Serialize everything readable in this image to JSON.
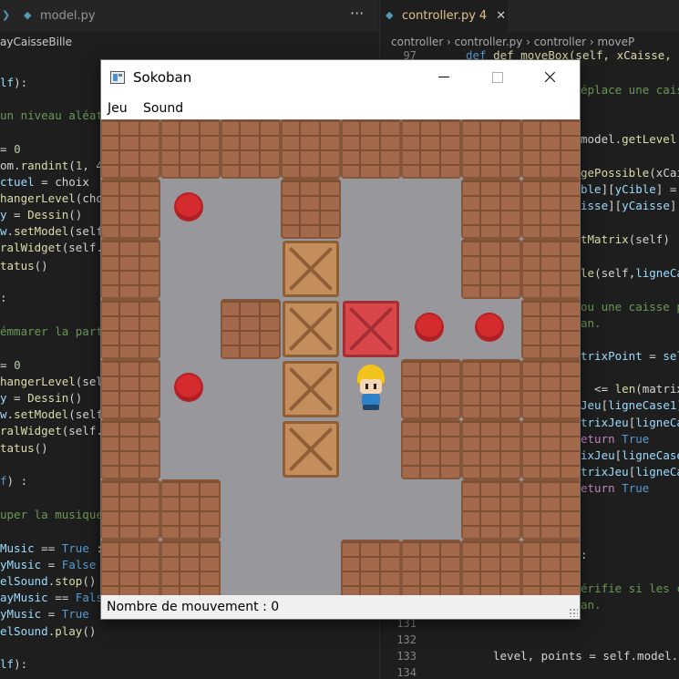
{
  "editor": {
    "left_tab": {
      "label": "model.py"
    },
    "left_breadcrumb": "ayCaisseBille",
    "right_tab": {
      "label": "controller.py",
      "badge": "4",
      "close": "✕"
    },
    "more_actions": "···",
    "right_breadcrumb": "controller  ›  controller.py  ›  controller  ›  moveP",
    "right_line_numbers": [
      "97",
      "131",
      "132",
      "133",
      "134"
    ],
    "right_top_code": "def moveBox(self, xCaisse, yCais",
    "right_bottom_code": "level, points = self.model.g"
  },
  "window": {
    "title": "Sokoban",
    "menu": [
      "Jeu",
      "Sound"
    ],
    "status_label": "Nombre de mouvement :",
    "move_count": "0"
  },
  "board": {
    "columns": 8,
    "rows": 8,
    "tiles": [
      "WWWWWWWW",
      "WG W  WW",
      "W  B  WW",
      "W WBRGGW",
      "WG BPWWW",
      "W  B WWW",
      "WW    WW",
      "WW  WWWW"
    ],
    "legend": {
      "W": "wall",
      "G": "goal",
      "B": "crate",
      "R": "crate-on-goal",
      "P": "player",
      " ": "floor"
    }
  }
}
